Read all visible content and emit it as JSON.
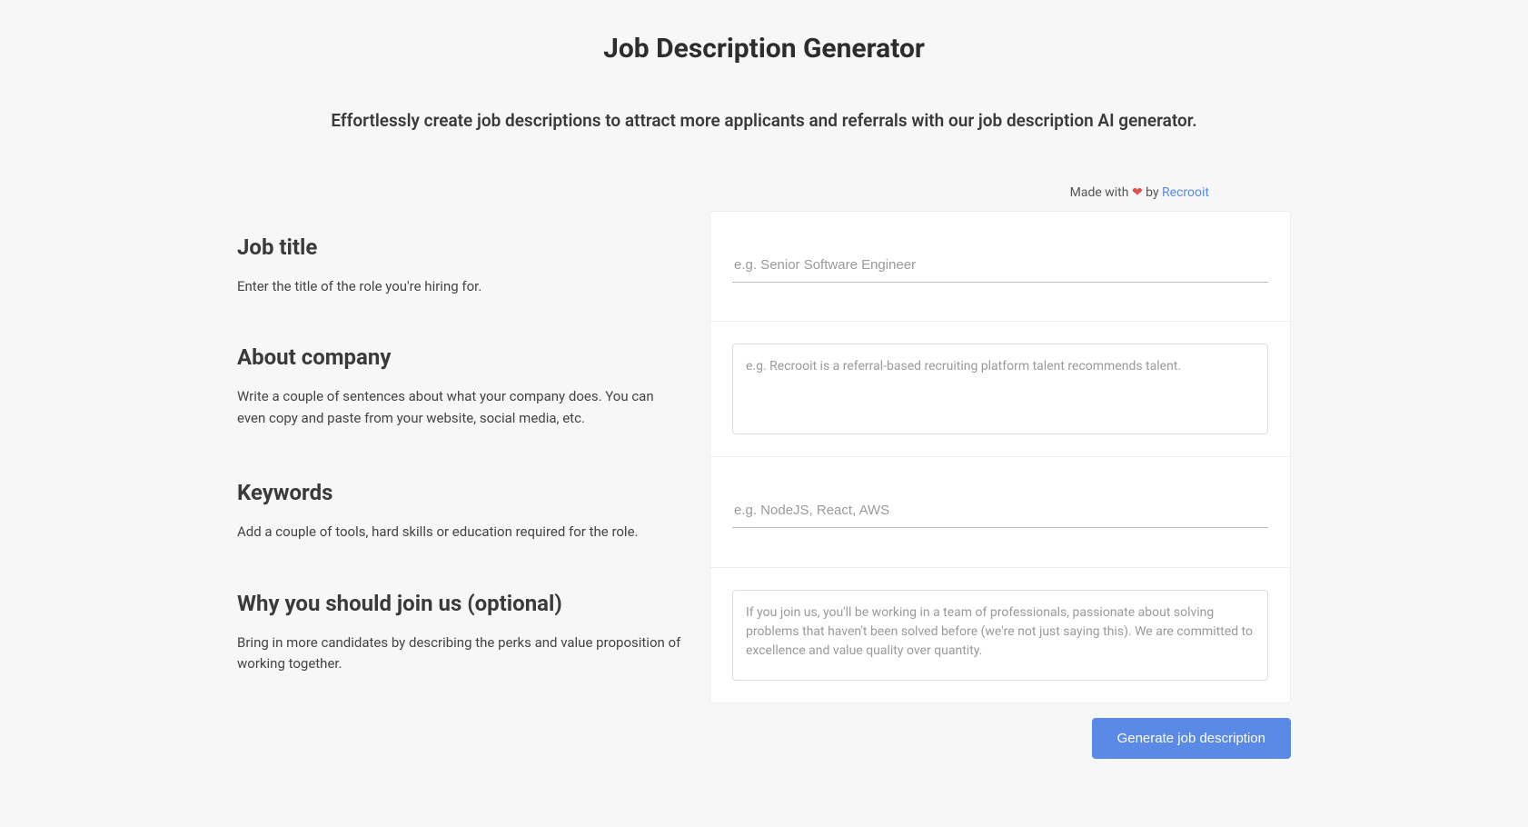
{
  "page": {
    "title": "Job Description Generator",
    "subtitle": "Effortlessly create job descriptions to attract more applicants and referrals with our job description AI generator."
  },
  "attribution": {
    "prefix": "Made with ",
    "heart": "❤",
    "by": " by ",
    "link_text": "Recrooit"
  },
  "sections": {
    "job_title": {
      "heading": "Job title",
      "description": "Enter the title of the role you're hiring for.",
      "placeholder": "e.g. Senior Software Engineer",
      "value": ""
    },
    "about_company": {
      "heading": "About company",
      "description": "Write a couple of sentences about what your company does. You can even copy and paste from your website, social media, etc.",
      "placeholder": "e.g. Recrooit is a referral-based recruiting platform talent recommends talent.",
      "value": ""
    },
    "keywords": {
      "heading": "Keywords",
      "description": "Add a couple of tools, hard skills or education required for the role.",
      "placeholder": "e.g. NodeJS, React, AWS",
      "value": ""
    },
    "why_join": {
      "heading": "Why you should join us (optional)",
      "description": "Bring in more candidates by describing the perks and value proposition of working together.",
      "placeholder": "If you join us, you'll be working in a team of professionals, passionate about solving problems that haven't been solved before (we're not just saying this). We are committed to excellence and value quality over quantity.",
      "value": ""
    }
  },
  "actions": {
    "generate_label": "Generate job description"
  }
}
